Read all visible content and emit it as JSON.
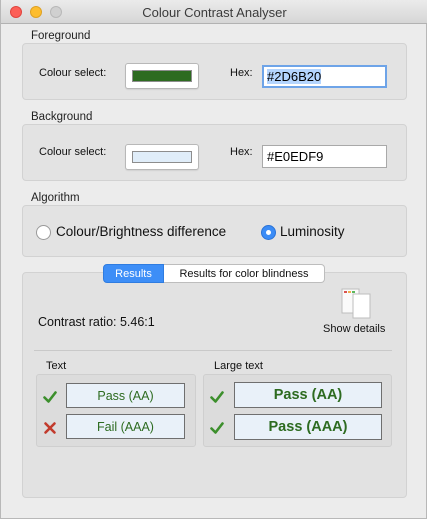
{
  "window": {
    "title": "Colour Contrast Analyser"
  },
  "foreground": {
    "section_label": "Foreground",
    "colour_select_label": "Colour select:",
    "hex_label": "Hex:",
    "hex_value": "#2D6B20",
    "swatch_color": "#2D6B20"
  },
  "background": {
    "section_label": "Background",
    "colour_select_label": "Colour select:",
    "hex_label": "Hex:",
    "hex_value": "#E0EDF9",
    "swatch_color": "#E0EDF9"
  },
  "algorithm": {
    "section_label": "Algorithm",
    "options": [
      {
        "label": "Colour/Brightness difference",
        "selected": false
      },
      {
        "label": "Luminosity",
        "selected": true
      }
    ]
  },
  "results": {
    "tabs": [
      {
        "label": "Results",
        "active": true
      },
      {
        "label": "Results for color blindness",
        "active": false
      }
    ],
    "contrast_ratio_text": "Contrast ratio: 5.46:1",
    "show_details_label": "Show details",
    "text_group": {
      "label": "Text",
      "items": [
        {
          "label": "Pass (AA)",
          "status": "pass"
        },
        {
          "label": "Fail (AAA)",
          "status": "fail"
        }
      ]
    },
    "large_text_group": {
      "label": "Large text",
      "items": [
        {
          "label": "Pass (AA)",
          "status": "pass"
        },
        {
          "label": "Pass (AAA)",
          "status": "pass"
        }
      ]
    }
  },
  "colors": {
    "pass_check": "#3c8f2c",
    "fail_cross": "#c23b2c",
    "accent": "#3d8ef7"
  }
}
